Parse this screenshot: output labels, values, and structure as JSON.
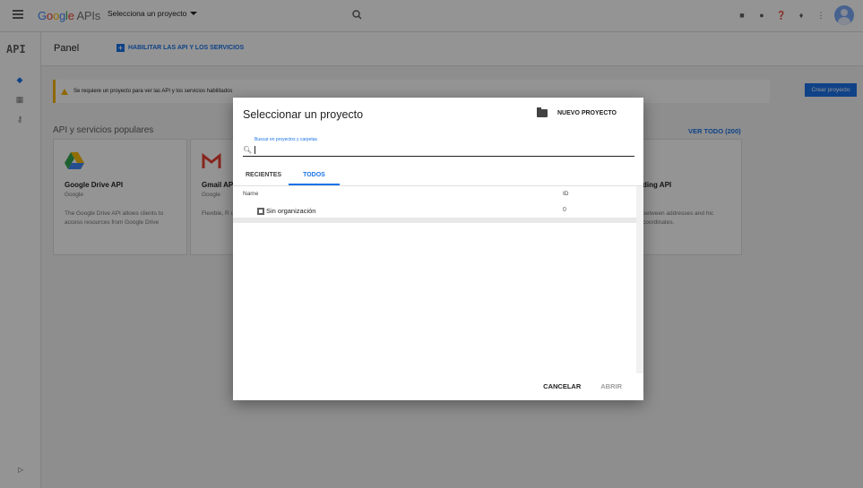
{
  "topbar": {
    "logo_google": "Google",
    "logo_apis": "APIs",
    "project_selector": "Selecciona un proyecto"
  },
  "rail": {
    "label": "API"
  },
  "panel": {
    "title": "Panel",
    "enable_button": "HABILITAR LAS API Y LOS SERVICIOS"
  },
  "warning": {
    "text": "Se requiere un proyecto para ver las API y los servicios habilitados"
  },
  "create_button": "Crear proyecto",
  "popular": {
    "title": "API y servicios populares",
    "view_all": "VER TODO (200)"
  },
  "cards": [
    {
      "title": "Google Drive API",
      "provider": "Google",
      "description": "The Google Drive API allows clients to access resources from Google Drive"
    },
    {
      "title": "Gmail AP",
      "provider": "Google",
      "description": "Flexible, R user's inbo"
    },
    {
      "title": "ding API",
      "provider": "",
      "description": "between addresses and hic coordinates."
    }
  ],
  "dialog": {
    "title": "Seleccionar un proyecto",
    "new_project": "NUEVO PROYECTO",
    "search_label": "Buscar en proyectos y carpetas",
    "tabs": [
      "RECIENTES",
      "TODOS"
    ],
    "active_tab": "TODOS",
    "columns": {
      "name": "Name",
      "id": "ID"
    },
    "rows": [
      {
        "name": "Sin organización",
        "id": "0"
      }
    ],
    "cancel": "CANCELAR",
    "open": "ABRIR"
  },
  "colors": {
    "accent": "#1a73e8",
    "warning": "#f4b400"
  }
}
